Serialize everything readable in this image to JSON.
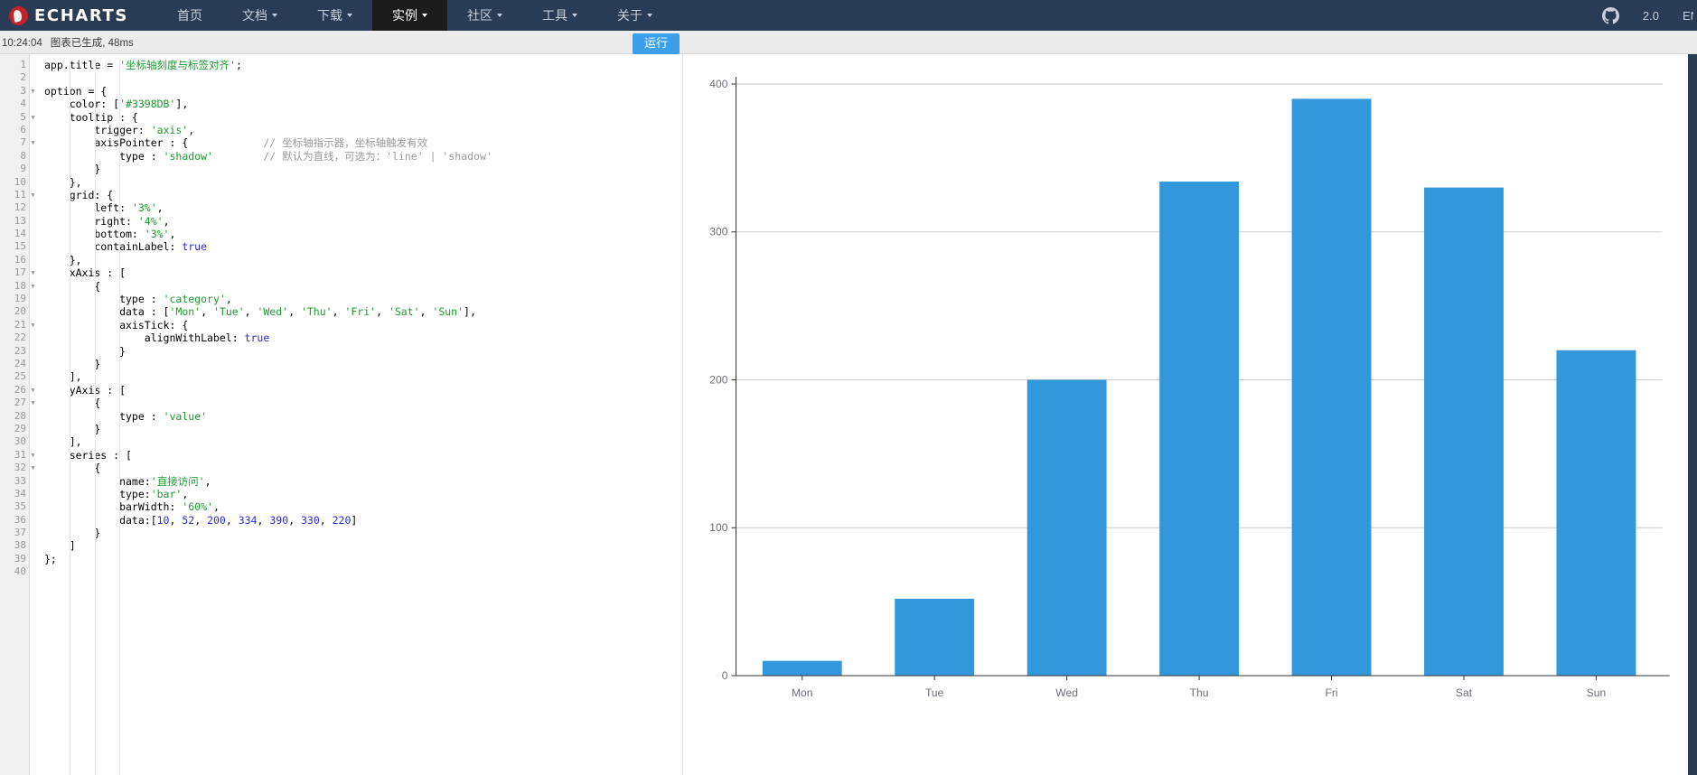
{
  "header": {
    "brand": "ECHARTS",
    "logo_icon": "echarts-logo-icon",
    "nav": [
      {
        "label": "首页",
        "has_caret": false,
        "active": false,
        "name": "nav-home"
      },
      {
        "label": "文档",
        "has_caret": true,
        "active": false,
        "name": "nav-docs"
      },
      {
        "label": "下载",
        "has_caret": true,
        "active": false,
        "name": "nav-download"
      },
      {
        "label": "实例",
        "has_caret": true,
        "active": true,
        "name": "nav-examples"
      },
      {
        "label": "社区",
        "has_caret": true,
        "active": false,
        "name": "nav-community"
      },
      {
        "label": "工具",
        "has_caret": true,
        "active": false,
        "name": "nav-tools"
      },
      {
        "label": "关于",
        "has_caret": true,
        "active": false,
        "name": "nav-about"
      }
    ],
    "github_icon": "github-icon",
    "version": "2.0",
    "language": "EN"
  },
  "statusbar": {
    "time": "10:24:04",
    "message": "图表已生成, 48ms",
    "run_label": "运行"
  },
  "editor": {
    "total_lines": 40,
    "fold_lines": [
      3,
      5,
      7,
      11,
      17,
      18,
      21,
      26,
      27,
      31,
      32
    ],
    "lines": [
      {
        "n": 1,
        "html": "app.title = <span class=\"tok-str\">'坐标轴刻度与标签对齐'</span>;"
      },
      {
        "n": 2,
        "html": ""
      },
      {
        "n": 3,
        "html": "option = {"
      },
      {
        "n": 4,
        "html": "    color: [<span class=\"tok-str\">'#3398DB'</span>],"
      },
      {
        "n": 5,
        "html": "    tooltip : {"
      },
      {
        "n": 6,
        "html": "        trigger: <span class=\"tok-str\">'axis'</span>,"
      },
      {
        "n": 7,
        "html": "        axisPointer : {            <span class=\"tok-com\">// 坐标轴指示器，坐标轴触发有效</span>"
      },
      {
        "n": 8,
        "html": "            type : <span class=\"tok-str\">'shadow'</span>        <span class=\"tok-com\">// 默认为直线，可选为：'line' | 'shadow'</span>"
      },
      {
        "n": 9,
        "html": "        }"
      },
      {
        "n": 10,
        "html": "    },"
      },
      {
        "n": 11,
        "html": "    grid: {"
      },
      {
        "n": 12,
        "html": "        left: <span class=\"tok-str\">'3%'</span>,"
      },
      {
        "n": 13,
        "html": "        right: <span class=\"tok-str\">'4%'</span>,"
      },
      {
        "n": 14,
        "html": "        bottom: <span class=\"tok-str\">'3%'</span>,"
      },
      {
        "n": 15,
        "html": "        containLabel: <span class=\"tok-key\">true</span>"
      },
      {
        "n": 16,
        "html": "    },"
      },
      {
        "n": 17,
        "html": "    xAxis : ["
      },
      {
        "n": 18,
        "html": "        {"
      },
      {
        "n": 19,
        "html": "            type : <span class=\"tok-str\">'category'</span>,"
      },
      {
        "n": 20,
        "html": "            data : [<span class=\"tok-str\">'Mon'</span>, <span class=\"tok-str\">'Tue'</span>, <span class=\"tok-str\">'Wed'</span>, <span class=\"tok-str\">'Thu'</span>, <span class=\"tok-str\">'Fri'</span>, <span class=\"tok-str\">'Sat'</span>, <span class=\"tok-str\">'Sun'</span>],"
      },
      {
        "n": 21,
        "html": "            axisTick: {"
      },
      {
        "n": 22,
        "html": "                alignWithLabel: <span class=\"tok-key\">true</span>"
      },
      {
        "n": 23,
        "html": "            }"
      },
      {
        "n": 24,
        "html": "        }"
      },
      {
        "n": 25,
        "html": "    ],"
      },
      {
        "n": 26,
        "html": "    yAxis : ["
      },
      {
        "n": 27,
        "html": "        {"
      },
      {
        "n": 28,
        "html": "            type : <span class=\"tok-str\">'value'</span>"
      },
      {
        "n": 29,
        "html": "        }"
      },
      {
        "n": 30,
        "html": "    ],"
      },
      {
        "n": 31,
        "html": "    series : ["
      },
      {
        "n": 32,
        "html": "        {"
      },
      {
        "n": 33,
        "html": "            name:<span class=\"tok-str\">'直接访问'</span>,"
      },
      {
        "n": 34,
        "html": "            type:<span class=\"tok-str\">'bar'</span>,"
      },
      {
        "n": 35,
        "html": "            barWidth: <span class=\"tok-str\">'60%'</span>,"
      },
      {
        "n": 36,
        "html": "            data:[<span class=\"tok-num\">10</span>, <span class=\"tok-num\">52</span>, <span class=\"tok-num\">200</span>, <span class=\"tok-num\">334</span>, <span class=\"tok-num\">390</span>, <span class=\"tok-num\">330</span>, <span class=\"tok-num\">220</span>]"
      },
      {
        "n": 37,
        "html": "        }"
      },
      {
        "n": 38,
        "html": "    ]"
      },
      {
        "n": 39,
        "html": "};"
      },
      {
        "n": 40,
        "html": ""
      }
    ]
  },
  "chart_data": {
    "type": "bar",
    "title": "坐标轴刻度与标签对齐",
    "series_name": "直接访问",
    "categories": [
      "Mon",
      "Tue",
      "Wed",
      "Thu",
      "Fri",
      "Sat",
      "Sun"
    ],
    "values": [
      10,
      52,
      200,
      334,
      390,
      330,
      220
    ],
    "color": "#3398DB",
    "bar_width_pct": "60%",
    "xlabel": "",
    "ylabel": "",
    "ylim": [
      0,
      400
    ],
    "y_ticks": [
      0,
      100,
      200,
      300,
      400
    ],
    "grid": true,
    "legend": false,
    "y_tick_labels": [
      "0",
      "100",
      "200",
      "300",
      "400"
    ]
  }
}
